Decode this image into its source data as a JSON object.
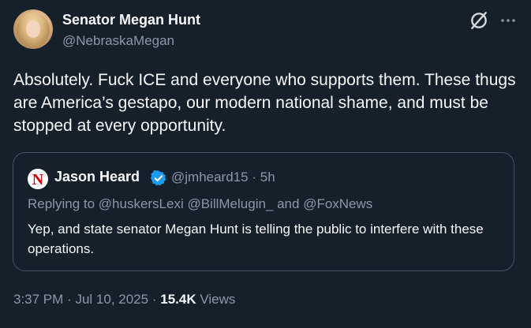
{
  "author": {
    "name": "Senator Megan Hunt",
    "handle": "@NebraskaMegan"
  },
  "tweet": {
    "text": "Absolutely. Fuck ICE and everyone who supports them. These thugs are America’s gestapo, our modern national shame, and must be stopped at every opportunity."
  },
  "quoted": {
    "name": "Jason Heard",
    "handle": "@jmheard15",
    "separator": "·",
    "age": "5h",
    "replying_to": "Replying to @huskersLexi @BillMelugin_ and @FoxNews",
    "text": "Yep, and state senator Megan Hunt is telling the public to interfere with these operations.",
    "logo_letter": "N"
  },
  "footer": {
    "time": "3:37 PM",
    "sep1": "·",
    "date": "Jul 10, 2025",
    "sep2": "·",
    "views": "15.4K",
    "views_label": "Views"
  },
  "icons": {
    "grok": "grok-icon",
    "more": "more-icon",
    "verified": "verified-icon"
  },
  "colors": {
    "background": "#15202b",
    "secondary_text": "#8b98a5",
    "verified_blue": "#1d9bf0",
    "logo_red": "#d00000"
  }
}
